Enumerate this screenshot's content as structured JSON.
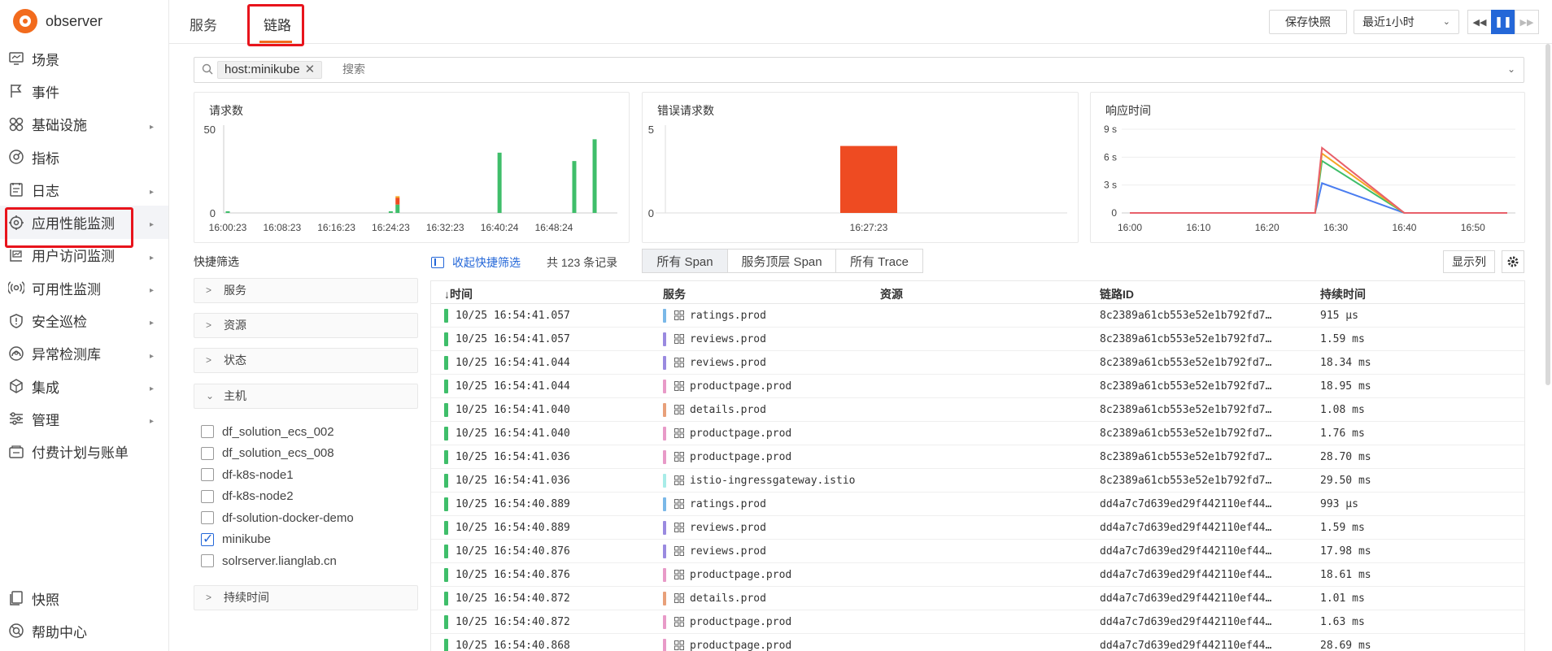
{
  "app": {
    "name": "observer"
  },
  "sidebar": {
    "items": [
      {
        "label": "场景",
        "icon": "scene-icon",
        "has_children": false
      },
      {
        "label": "事件",
        "icon": "flag-icon",
        "has_children": false
      },
      {
        "label": "基础设施",
        "icon": "infrastructure-icon",
        "has_children": true
      },
      {
        "label": "指标",
        "icon": "metrics-icon",
        "has_children": false
      },
      {
        "label": "日志",
        "icon": "log-icon",
        "has_children": true
      },
      {
        "label": "应用性能监测",
        "icon": "apm-icon",
        "has_children": true,
        "active": true
      },
      {
        "label": "用户访问监测",
        "icon": "rum-icon",
        "has_children": true
      },
      {
        "label": "可用性监测",
        "icon": "availability-icon",
        "has_children": true
      },
      {
        "label": "安全巡检",
        "icon": "shield-icon",
        "has_children": true
      },
      {
        "label": "异常检测库",
        "icon": "anomaly-icon",
        "has_children": true
      },
      {
        "label": "集成",
        "icon": "integration-icon",
        "has_children": true
      },
      {
        "label": "管理",
        "icon": "settings-sliders-icon",
        "has_children": true
      },
      {
        "label": "付费计划与账单",
        "icon": "billing-icon",
        "has_children": false
      }
    ],
    "bottom": [
      {
        "label": "快照",
        "icon": "snapshot-icon"
      },
      {
        "label": "帮助中心",
        "icon": "help-icon"
      }
    ]
  },
  "topbar": {
    "tabs": [
      {
        "label": "服务"
      },
      {
        "label": "链路",
        "active": true
      }
    ],
    "save_snapshot": "保存快照",
    "time_range": "最近1小时"
  },
  "search": {
    "chip": "host:minikube",
    "placeholder": "搜索"
  },
  "charts": {
    "requests": {
      "title": "请求数"
    },
    "errors": {
      "title": "错误请求数"
    },
    "latency": {
      "title": "响应时间"
    }
  },
  "chart_data": [
    {
      "type": "bar",
      "title": "请求数",
      "categories": [
        "16:00:23",
        "16:24:23",
        "16:25:23",
        "16:40:24",
        "16:51:24",
        "16:54:24"
      ],
      "series": [
        {
          "color": "#3fbe6a",
          "values": [
            1,
            1,
            5,
            36,
            31,
            44
          ]
        },
        {
          "color": "#ee4b22",
          "values": [
            0,
            0,
            4,
            0,
            0,
            0
          ]
        },
        {
          "color": "#f5a623",
          "values": [
            0,
            0,
            1,
            0,
            0,
            0
          ]
        }
      ],
      "xticks": [
        "16:00:23",
        "16:08:23",
        "16:16:23",
        "16:24:23",
        "16:32:23",
        "16:40:24",
        "16:48:24"
      ],
      "yticks": [
        0,
        50
      ],
      "ylim": [
        0,
        50
      ],
      "xlim_minutes": [
        0,
        60
      ]
    },
    {
      "type": "bar",
      "title": "错误请求数",
      "categories": [
        "16:27:23"
      ],
      "values": [
        4
      ],
      "color": "#ee4b22",
      "xticks": [
        "16:27:23"
      ],
      "yticks": [
        0,
        5
      ],
      "ylim": [
        0,
        5
      ]
    },
    {
      "type": "line",
      "title": "响应时间",
      "unit": "s",
      "xticks": [
        "16:00",
        "16:10",
        "16:20",
        "16:30",
        "16:40",
        "16:50"
      ],
      "yticks": [
        "0",
        "3 s",
        "6 s",
        "9 s"
      ],
      "ylim": [
        0,
        9
      ],
      "x": [
        "16:00",
        "16:27",
        "16:28",
        "16:40",
        "16:55"
      ],
      "series": [
        {
          "color": "#e8606a",
          "values": [
            0,
            0,
            7.0,
            0,
            0
          ]
        },
        {
          "color": "#f5a623",
          "values": [
            0,
            0,
            6.4,
            0,
            0
          ]
        },
        {
          "color": "#3fbe6a",
          "values": [
            0,
            0,
            5.6,
            0,
            0
          ]
        },
        {
          "color": "#4a7df0",
          "values": [
            0,
            0,
            3.2,
            0,
            0
          ]
        }
      ]
    }
  ],
  "quick_filter": {
    "title": "快捷筛选",
    "collapse_label": "收起快捷筛选",
    "facets": [
      {
        "label": "服务",
        "expanded": false
      },
      {
        "label": "资源",
        "expanded": false
      },
      {
        "label": "状态",
        "expanded": false
      },
      {
        "label": "主机",
        "expanded": true
      }
    ],
    "hosts": [
      {
        "name": "df_solution_ecs_002",
        "checked": false
      },
      {
        "name": "df_solution_ecs_008",
        "checked": false
      },
      {
        "name": "df-k8s-node1",
        "checked": false
      },
      {
        "name": "df-k8s-node2",
        "checked": false
      },
      {
        "name": "df-solution-docker-demo",
        "checked": false
      },
      {
        "name": "minikube",
        "checked": true
      },
      {
        "name": "solrserver.lianglab.cn",
        "checked": false
      }
    ],
    "duration_facet": "持续时间"
  },
  "table_toolbar": {
    "count": "共 123 条记录",
    "segments": [
      "所有 Span",
      "服务顶层 Span",
      "所有 Trace"
    ],
    "show_columns": "显示列"
  },
  "table": {
    "columns": [
      "时间",
      "服务",
      "资源",
      "链路ID",
      "持续时间"
    ],
    "sort_indicator": "↓",
    "rows": [
      {
        "time": "10/25 16:54:41.057",
        "service": "ratings.prod",
        "svc_color": "#7ab8e8",
        "trace_id": "8c2389a61cb553e52e1b792fd7…",
        "duration": "915 µs"
      },
      {
        "time": "10/25 16:54:41.057",
        "service": "reviews.prod",
        "svc_color": "#9a8ae0",
        "trace_id": "8c2389a61cb553e52e1b792fd7…",
        "duration": "1.59 ms"
      },
      {
        "time": "10/25 16:54:41.044",
        "service": "reviews.prod",
        "svc_color": "#9a8ae0",
        "trace_id": "8c2389a61cb553e52e1b792fd7…",
        "duration": "18.34 ms"
      },
      {
        "time": "10/25 16:54:41.044",
        "service": "productpage.prod",
        "svc_color": "#e89ac8",
        "trace_id": "8c2389a61cb553e52e1b792fd7…",
        "duration": "18.95 ms"
      },
      {
        "time": "10/25 16:54:41.040",
        "service": "details.prod",
        "svc_color": "#e8a07a",
        "trace_id": "8c2389a61cb553e52e1b792fd7…",
        "duration": "1.08 ms"
      },
      {
        "time": "10/25 16:54:41.040",
        "service": "productpage.prod",
        "svc_color": "#e89ac8",
        "trace_id": "8c2389a61cb553e52e1b792fd7…",
        "duration": "1.76 ms"
      },
      {
        "time": "10/25 16:54:41.036",
        "service": "productpage.prod",
        "svc_color": "#e89ac8",
        "trace_id": "8c2389a61cb553e52e1b792fd7…",
        "duration": "28.70 ms"
      },
      {
        "time": "10/25 16:54:41.036",
        "service": "istio-ingressgateway.istio",
        "svc_color": "#a8ece8",
        "trace_id": "8c2389a61cb553e52e1b792fd7…",
        "duration": "29.50 ms"
      },
      {
        "time": "10/25 16:54:40.889",
        "service": "ratings.prod",
        "svc_color": "#7ab8e8",
        "trace_id": "dd4a7c7d639ed29f442110ef44…",
        "duration": "993 µs"
      },
      {
        "time": "10/25 16:54:40.889",
        "service": "reviews.prod",
        "svc_color": "#9a8ae0",
        "trace_id": "dd4a7c7d639ed29f442110ef44…",
        "duration": "1.59 ms"
      },
      {
        "time": "10/25 16:54:40.876",
        "service": "reviews.prod",
        "svc_color": "#9a8ae0",
        "trace_id": "dd4a7c7d639ed29f442110ef44…",
        "duration": "17.98 ms"
      },
      {
        "time": "10/25 16:54:40.876",
        "service": "productpage.prod",
        "svc_color": "#e89ac8",
        "trace_id": "dd4a7c7d639ed29f442110ef44…",
        "duration": "18.61 ms"
      },
      {
        "time": "10/25 16:54:40.872",
        "service": "details.prod",
        "svc_color": "#e8a07a",
        "trace_id": "dd4a7c7d639ed29f442110ef44…",
        "duration": "1.01 ms"
      },
      {
        "time": "10/25 16:54:40.872",
        "service": "productpage.prod",
        "svc_color": "#e89ac8",
        "trace_id": "dd4a7c7d639ed29f442110ef44…",
        "duration": "1.63 ms"
      },
      {
        "time": "10/25 16:54:40.868",
        "service": "productpage.prod",
        "svc_color": "#e89ac8",
        "trace_id": "dd4a7c7d639ed29f442110ef44…",
        "duration": "28.69 ms"
      }
    ]
  }
}
